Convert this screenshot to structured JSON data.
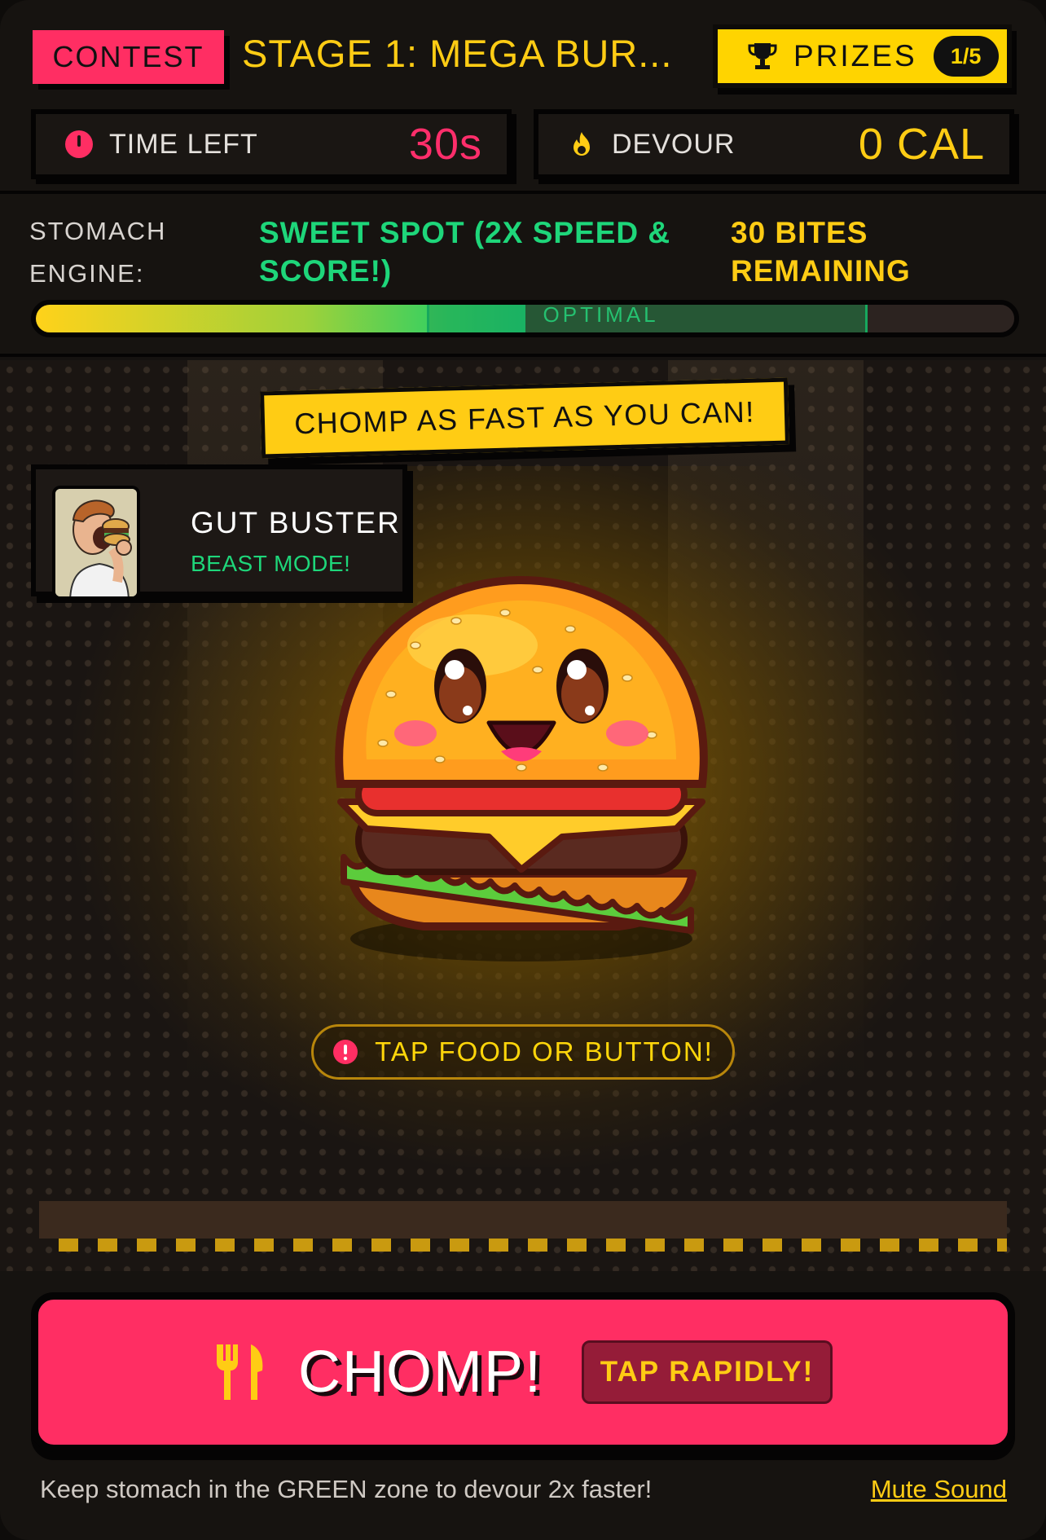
{
  "header": {
    "contest_label": "CONTEST",
    "stage_title": "STAGE 1: MEGA BUR...",
    "prizes_label": "PRIZES",
    "prizes_count": "1/5"
  },
  "stats": {
    "time_left_label": "TIME LEFT",
    "time_left_value": "30s",
    "devour_label": "DEVOUR",
    "devour_value": "0 CAL"
  },
  "stomach_engine": {
    "label_line1": "STOMACH",
    "label_line2": "ENGINE:",
    "status_line1": "SWEET SPOT (2X SPEED &",
    "status_line2": "SCORE!)",
    "bites_line1": "30 BITES",
    "bites_line2": "REMAINING",
    "meter_level": 0.5,
    "optimal_zone": [
      0.4,
      0.85
    ],
    "zone_label": "OPTIMAL"
  },
  "arena": {
    "banner": "CHOMP AS FAST AS YOU CAN!",
    "player_name": "GUT BUSTER",
    "player_mode": "BEAST MODE!",
    "hint": "TAP FOOD OR BUTTON!"
  },
  "controls": {
    "chomp_label": "CHOMP!",
    "rapid_badge": "TAP RAPIDLY!",
    "footer_tip": "Keep stomach in the GREEN zone to devour 2x faster!",
    "mute_label": "Mute Sound"
  },
  "colors": {
    "accent_pink": "#ff2e63",
    "accent_yellow": "#ffcc14",
    "accent_green": "#1ed67a"
  },
  "icons": {
    "prizes": "trophy-icon",
    "time": "alert-circle-icon",
    "devour": "flame-icon",
    "hint": "alert-circle-icon",
    "chomp": "fork-knife-icon"
  }
}
